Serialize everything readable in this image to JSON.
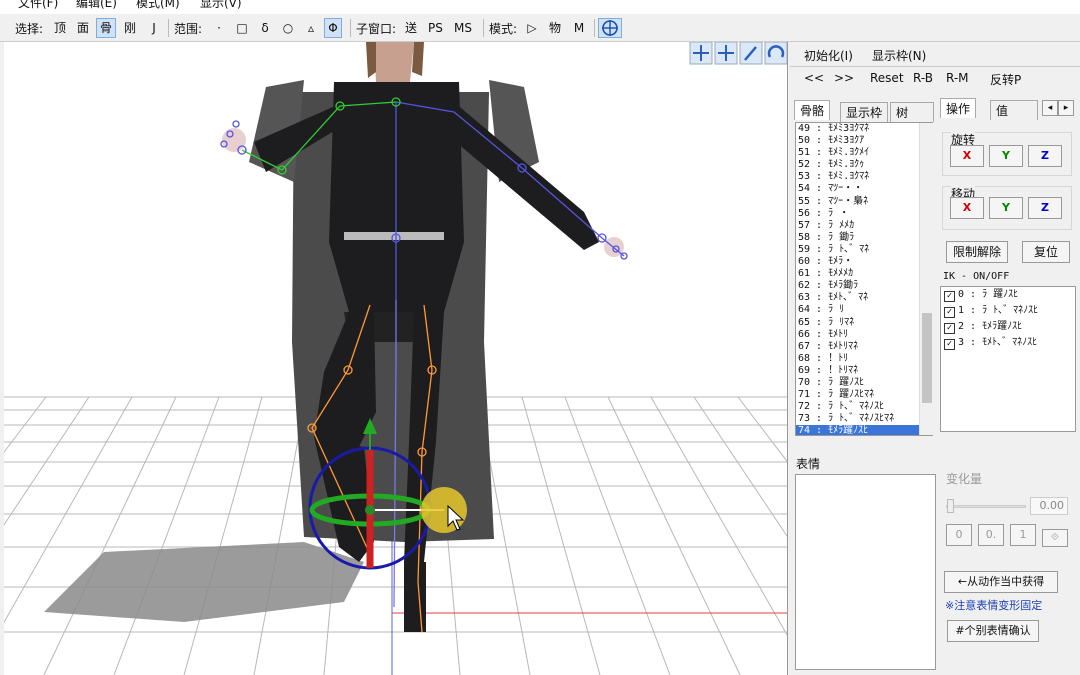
{
  "menu": {
    "file": "文件(F)",
    "edit": "编辑(E)",
    "mode": "模式(M)",
    "display": "显示(V)"
  },
  "toolbar": {
    "select_label": "选择:",
    "sel_top": "顶",
    "sel_face": "面",
    "sel_bone": "骨",
    "sel_rigid": "刚",
    "sel_joint": "J",
    "range_label": "范围:",
    "r1": "·",
    "r2": "□",
    "r3": "δ",
    "r4": "○",
    "r5": "▵",
    "r6": "Φ",
    "sub_label": "子窗口:",
    "sub1": "送",
    "sub2": "PS",
    "sub3": "MS",
    "mode_label": "模式:",
    "mode1": "▷",
    "mode2": "物",
    "mode3": "M"
  },
  "right_panel": {
    "init_button": "初始化(I)",
    "display_frame_button": "显示枠(N)",
    "prev": "<<",
    "next": ">>",
    "reset": "Reset",
    "rb": "R-B",
    "rm": "R-M",
    "flip": "反转P",
    "tabs_left": [
      "骨骼",
      "显示枠",
      "树"
    ],
    "tabs_right": [
      "操作",
      "值"
    ],
    "bones": [
      "49 : ﾓﾒﾐ3ﾖｸﾏﾈ",
      "50 : ﾓﾒﾐ3ﾖｸｱ",
      "51 : ﾓﾒﾐ.ﾖｸﾒｲ",
      "52 : ﾓﾒﾐ.ﾖｸｩ",
      "53 : ﾓﾒﾐ.ﾖｸﾏﾈ",
      "54 : ﾏﾂｰ・・",
      "55 : ﾏﾂｰ・梟ﾈ",
      "56 : ﾗ  ・",
      "57 : ﾗ  ﾒﾒｶ",
      "58 : ﾗ  鋤ﾗ",
      "59 : ﾗ  ﾄ､゛ﾏﾈ",
      "60 : ﾓﾒﾗ・",
      "61 : ﾓﾒﾒﾒｶ",
      "62 : ﾓﾒﾗ鋤ﾗ",
      "63 : ﾓﾒﾄ､゛ﾏﾈ",
      "64 : ﾗ  ﾘ",
      "65 : ﾗ  ﾘﾏﾈ",
      "66 : ﾓﾒﾄﾘ",
      "67 : ﾓﾒﾄﾘﾏﾈ",
      "68 : ！ﾄﾘ",
      "69 : ！ﾄﾘﾏﾈ",
      "70 : ﾗ  躍ﾉｽﾋ",
      "71 : ﾗ  躍ﾉｽﾋﾏﾈ",
      "72 : ﾗ  ﾄ､゛ﾏﾈﾉｽﾋ",
      "73 : ﾗ  ﾄ､゛ﾏﾈﾉｽﾋﾏﾈ",
      "74 : ﾓﾒﾗ躍ﾉｽﾋ"
    ],
    "selected_bone_index": 25,
    "rotate_label": "旋转",
    "move_label": "移动",
    "x": "X",
    "y": "Y",
    "z": "Z",
    "unlock_button": "限制解除",
    "reset_pos_button": "复位",
    "ik_label": "IK - ON/OFF",
    "ik_items": [
      "0 : ﾗ  躍ﾉｽﾋ",
      "1 : ﾗ  ﾄ､゛ﾏﾈﾉｽﾋ",
      "2 : ﾓﾒﾗ躍ﾉｽﾋ",
      "3 : ﾓﾒﾄ､゛ﾏﾈﾉｽﾋ"
    ],
    "expression_label": "表情",
    "morph_label": "变化量",
    "morph_value": "0.00",
    "m0": "0",
    "m1": "0.",
    "m2": "1",
    "get_from_motion": "←从动作当中获得",
    "note": "※注意表情变形固定",
    "confirm_button": "#个别表情确认"
  },
  "colors": {
    "x": "#cc0000",
    "y": "#008800",
    "z": "#0000cc",
    "note": "#1a3fb4",
    "selection": "#3b75d8"
  }
}
